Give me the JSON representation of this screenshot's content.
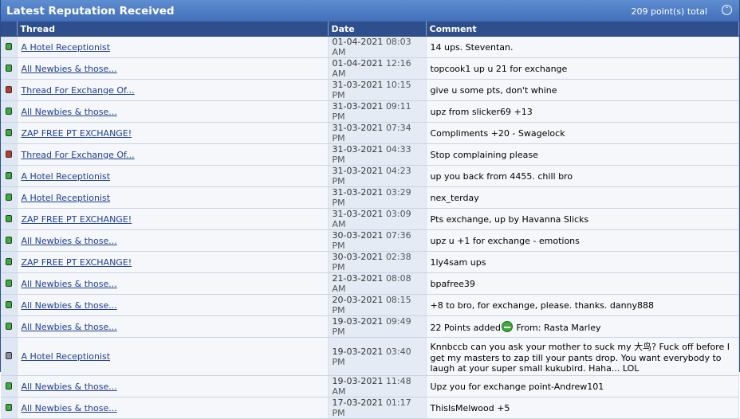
{
  "header": {
    "title": "Latest Reputation Received",
    "total": "209 point(s) total"
  },
  "columns": {
    "thread": "Thread",
    "date": "Date",
    "comment": "Comment"
  },
  "rows": [
    {
      "status": "green",
      "thread": "A Hotel Receptionist",
      "date": "01-04-2021",
      "time": "08:03 AM",
      "comment": "14 ups. Steventan."
    },
    {
      "status": "green",
      "thread": "All Newbies & those...",
      "date": "01-04-2021",
      "time": "12:16 AM",
      "comment": "topcook1 up u 21 for exchange"
    },
    {
      "status": "red",
      "thread": "Thread For Exchange Of...",
      "date": "31-03-2021",
      "time": "10:15 PM",
      "comment": "give u some pts, don't whine"
    },
    {
      "status": "green",
      "thread": "All Newbies & those...",
      "date": "31-03-2021",
      "time": "09:11 PM",
      "comment": "upz from slicker69 +13"
    },
    {
      "status": "green",
      "thread": "ZAP FREE PT EXCHANGE!",
      "date": "31-03-2021",
      "time": "07:34 PM",
      "comment": "Compliments +20 - Swagelock"
    },
    {
      "status": "red",
      "thread": "Thread For Exchange Of...",
      "date": "31-03-2021",
      "time": "04:33 PM",
      "comment": "Stop complaining please"
    },
    {
      "status": "green",
      "thread": "A Hotel Receptionist",
      "date": "31-03-2021",
      "time": "04:23 PM",
      "comment": "up you back from 4455. chill bro"
    },
    {
      "status": "green",
      "thread": "A Hotel Receptionist",
      "date": "31-03-2021",
      "time": "03:29 PM",
      "comment": "nex_terday"
    },
    {
      "status": "green",
      "thread": "ZAP FREE PT EXCHANGE!",
      "date": "31-03-2021",
      "time": "03:09 AM",
      "comment": "Pts exchange, up by Havanna Slicks"
    },
    {
      "status": "green",
      "thread": "All Newbies & those...",
      "date": "30-03-2021",
      "time": "07:36 PM",
      "comment": "upz u +1 for exchange - emotions"
    },
    {
      "status": "green",
      "thread": "ZAP FREE PT EXCHANGE!",
      "date": "30-03-2021",
      "time": "02:38 PM",
      "comment": "1ly4sam ups"
    },
    {
      "status": "green",
      "thread": "All Newbies & those...",
      "date": "21-03-2021",
      "time": "08:08 AM",
      "comment": "bpafree39"
    },
    {
      "status": "green",
      "thread": "All Newbies & those...",
      "date": "20-03-2021",
      "time": "08:15 PM",
      "comment": "+8 to bro, for exchange, please. thanks. danny888"
    },
    {
      "status": "green",
      "thread": "All Newbies & those...",
      "date": "19-03-2021",
      "time": "09:49 PM",
      "comment": "22 Points added",
      "comment_suffix": "From: Rasta Marley",
      "smiley": true
    },
    {
      "status": "grey",
      "thread": "A Hotel Receptionist",
      "date": "19-03-2021",
      "time": "03:40 PM",
      "comment": "Knnbccb can you ask your mother to suck my 大鸟? Fuck off before I get my masters to zap till your pants drop. You want everybody to laugh at your super small kukubird. Haha... LOL",
      "tall": true
    },
    {
      "status": "green",
      "thread": "All Newbies & those...",
      "date": "19-03-2021",
      "time": "11:48 AM",
      "comment": "Upz you for exchange point-Andrew101"
    },
    {
      "status": "green",
      "thread": "All Newbies & those...",
      "date": "17-03-2021",
      "time": "01:17 PM",
      "comment": "ThisIsMelwood +5"
    }
  ]
}
